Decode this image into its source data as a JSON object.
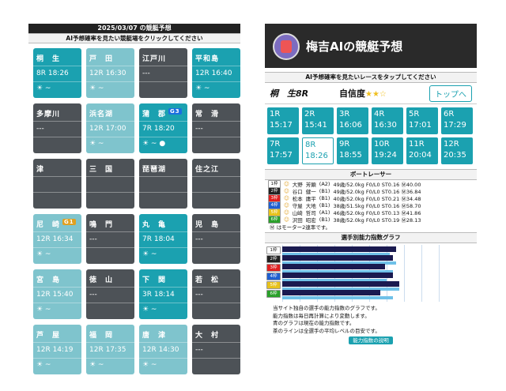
{
  "left": {
    "header": "2025/03/07 の競艇予想",
    "subheader": "AI予想確率を見たい競艇場をクリックしてください",
    "venues": [
      {
        "name": "桐　生",
        "race": "8R 18:26",
        "style": "teal",
        "icons": "☀ ~"
      },
      {
        "name": "戸　田",
        "race": "12R 16:30",
        "style": "lteal",
        "icons": "☀ ~"
      },
      {
        "name": "江戸川",
        "race": "---",
        "style": "gray",
        "icons": ""
      },
      {
        "name": "平和島",
        "race": "12R 16:40",
        "style": "teal",
        "icons": "☀ ~"
      },
      {
        "name": "多摩川",
        "race": "---",
        "style": "gray",
        "icons": ""
      },
      {
        "name": "浜名湖",
        "race": "12R 17:00",
        "style": "lteal",
        "icons": "☀ ~"
      },
      {
        "name": "蒲　郡",
        "race": "7R 18:20",
        "style": "teal",
        "icons": "☀ ~ ●",
        "badge": "G3"
      },
      {
        "name": "常　滑",
        "race": "---",
        "style": "gray",
        "icons": ""
      },
      {
        "name": "津",
        "race": "",
        "style": "gray",
        "icons": ""
      },
      {
        "name": "三　国",
        "race": "",
        "style": "gray",
        "icons": ""
      },
      {
        "name": "琵琶湖",
        "race": "",
        "style": "gray",
        "icons": ""
      },
      {
        "name": "住之江",
        "race": "",
        "style": "gray",
        "icons": ""
      },
      {
        "name": "尼　崎",
        "race": "12R 16:34",
        "style": "lteal",
        "icons": "☀ ~",
        "badge": "G1"
      },
      {
        "name": "鳴　門",
        "race": "---",
        "style": "gray",
        "icons": ""
      },
      {
        "name": "丸　亀",
        "race": "7R 18:04",
        "style": "teal",
        "icons": "☀ ~"
      },
      {
        "name": "児　島",
        "race": "---",
        "style": "gray",
        "icons": ""
      },
      {
        "name": "宮　島",
        "race": "12R 15:40",
        "style": "lteal",
        "icons": "☀ ~"
      },
      {
        "name": "徳　山",
        "race": "---",
        "style": "gray",
        "icons": ""
      },
      {
        "name": "下　関",
        "race": "3R 18:14",
        "style": "teal",
        "icons": "☀ ~"
      },
      {
        "name": "若　松",
        "race": "---",
        "style": "gray",
        "icons": ""
      },
      {
        "name": "芦　屋",
        "race": "12R 14:19",
        "style": "lteal",
        "icons": "☀ ~"
      },
      {
        "name": "福　岡",
        "race": "12R 17:35",
        "style": "lteal",
        "icons": "☀ ~"
      },
      {
        "name": "唐　津",
        "race": "12R 14:30",
        "style": "lteal",
        "icons": "☀ ~"
      },
      {
        "name": "大　村",
        "race": "---",
        "style": "gray",
        "icons": ""
      }
    ]
  },
  "right": {
    "title": "梅吉AIの競艇予想",
    "subheader": "AI予想確率を見たいレースをタップしてください",
    "venue": "桐　生8R",
    "confidence_label": "自信度",
    "confidence_stars": "★★☆",
    "top_button": "トップへ",
    "races": [
      {
        "r": "1R",
        "t": "15:17"
      },
      {
        "r": "2R",
        "t": "15:41"
      },
      {
        "r": "3R",
        "t": "16:06"
      },
      {
        "r": "4R",
        "t": "16:30"
      },
      {
        "r": "5R",
        "t": "17:01"
      },
      {
        "r": "6R",
        "t": "17:29"
      },
      {
        "r": "7R",
        "t": "17:57"
      },
      {
        "r": "8R",
        "t": "18:26",
        "sel": true
      },
      {
        "r": "9R",
        "t": "18:55"
      },
      {
        "r": "10R",
        "t": "19:24"
      },
      {
        "r": "11R",
        "t": "20:04"
      },
      {
        "r": "12R",
        "t": "20:35"
      }
    ],
    "racers_title": "ボートレーサー",
    "racers": [
      {
        "waku": "1枠",
        "color": "#ffffff",
        "tcolor": "#111",
        "name": "大野",
        "given": "芳顕",
        "grade": "(A2)",
        "stats": "49歳/52.0kg F0/L0 ST0.16 Ⓜ40.00"
      },
      {
        "waku": "2枠",
        "color": "#222222",
        "tcolor": "#fff",
        "name": "谷口",
        "given": "健一",
        "grade": "(B1)",
        "stats": "49歳/52.0kg F0/L0 ST0.16 Ⓜ36.84"
      },
      {
        "waku": "3枠",
        "color": "#e02020",
        "tcolor": "#fff",
        "name": "松本",
        "given": "庸平",
        "grade": "(B1)",
        "stats": "40歳/52.0kg F0/L0 ST0.21 Ⓜ34.48"
      },
      {
        "waku": "4枠",
        "color": "#1f5fd0",
        "tcolor": "#fff",
        "name": "守屋",
        "given": "大地",
        "grade": "(B1)",
        "stats": "38歳/51.5kg F0/L0 ST0.16 Ⓜ58.70"
      },
      {
        "waku": "5枠",
        "color": "#e8c21a",
        "tcolor": "#fff",
        "name": "山崎",
        "given": "哲司",
        "grade": "(A1)",
        "stats": "46歳/52.0kg F0/L0 ST0.13 Ⓜ41.86"
      },
      {
        "waku": "6枠",
        "color": "#2aa02a",
        "tcolor": "#fff",
        "name": "沢田",
        "given": "昭宏",
        "grade": "(B1)",
        "stats": "38歳/52.0kg F0/L0 ST0.19 Ⓜ28.13"
      }
    ],
    "motor_note": "Ⓜ はモーター2連率です。",
    "graph_title": "選手別能力指数グラフ",
    "graph": [
      {
        "w": "1枠",
        "color": "#ffffff",
        "tcolor": "#111",
        "v": 0.72,
        "a": 0.68
      },
      {
        "w": "2枠",
        "color": "#222222",
        "tcolor": "#fff",
        "v": 0.7,
        "a": 0.72
      },
      {
        "w": "3枠",
        "color": "#e02020",
        "tcolor": "#fff",
        "v": 0.65,
        "a": 0.7
      },
      {
        "w": "4枠",
        "color": "#1f5fd0",
        "tcolor": "#fff",
        "v": 0.7,
        "a": 0.66
      },
      {
        "w": "5枠",
        "color": "#e8c21a",
        "tcolor": "#fff",
        "v": 0.74,
        "a": 0.74
      },
      {
        "w": "6枠",
        "color": "#2aa02a",
        "tcolor": "#fff",
        "v": 0.62,
        "a": 0.7
      }
    ],
    "desc": [
      "当サイト独自の選手の能力指数のグラフです。",
      "能力指数は毎日再計算により変動します。",
      "青のグラフは現在の能力指数です。",
      "茶のラインは全選手の平均レベルの目安です。"
    ],
    "desc_button": "能力指数の説明"
  }
}
